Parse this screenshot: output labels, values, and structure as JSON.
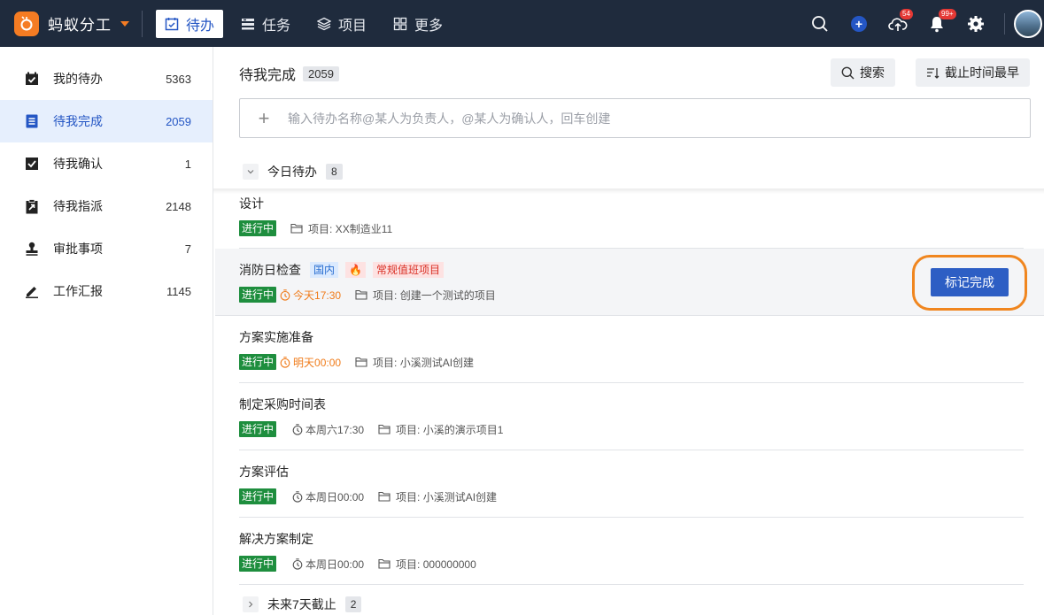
{
  "app": {
    "name": "蚂蚁分工",
    "logo_glyph": "ⓐ"
  },
  "nav": [
    {
      "label": "待办",
      "icon": "todo-icon",
      "active": true
    },
    {
      "label": "任务",
      "icon": "task-icon",
      "active": false
    },
    {
      "label": "项目",
      "icon": "layers-icon",
      "active": false
    },
    {
      "label": "更多",
      "icon": "grid-icon",
      "active": false
    }
  ],
  "top_badges": {
    "cloud": "54",
    "bell": "99+"
  },
  "sidebar": [
    {
      "label": "我的待办",
      "count": "5363",
      "icon": "calendar-check-icon"
    },
    {
      "label": "待我完成",
      "count": "2059",
      "icon": "doc-icon",
      "active": true
    },
    {
      "label": "待我确认",
      "count": "1",
      "icon": "checkbox-icon"
    },
    {
      "label": "待我指派",
      "count": "2148",
      "icon": "assign-icon"
    },
    {
      "label": "审批事项",
      "count": "7",
      "icon": "stamp-icon"
    },
    {
      "label": "工作汇报",
      "count": "1145",
      "icon": "pen-icon"
    }
  ],
  "main": {
    "title": "待我完成",
    "count": "2059",
    "search_label": "搜索",
    "sort_label": "截止时间最早",
    "new_placeholder": "输入待办名称@某人为负责人，@某人为确认人，回车创建"
  },
  "groups": {
    "today": {
      "label": "今日待办",
      "count": "8"
    },
    "next7": {
      "label": "未来7天截止",
      "count": "2"
    }
  },
  "tasks": [
    {
      "title": "设计",
      "status": "进行中",
      "due": "",
      "project": "项目: XX制造业11"
    },
    {
      "title": "消防日检查",
      "status": "进行中",
      "due": "今天17:30",
      "project": "项目: 创建一个测试的项目",
      "tags": [
        "国内",
        "🔥",
        "常规值班项目"
      ],
      "action": "标记完成"
    },
    {
      "title": "方案实施准备",
      "status": "进行中",
      "due": "明天00:00",
      "project": "项目: 小溪测试AI创建"
    },
    {
      "title": "制定采购时间表",
      "status": "进行中",
      "due": "本周六17:30",
      "project": "项目: 小溪的演示项目1"
    },
    {
      "title": "方案评估",
      "status": "进行中",
      "due": "本周日00:00",
      "project": "项目: 小溪测试AI创建"
    },
    {
      "title": "解决方案制定",
      "status": "进行中",
      "due": "本周日00:00",
      "project": "项目: 000000000"
    }
  ],
  "colors": {
    "topbar": "#1f2b3d",
    "accent": "#2456c4",
    "status_green": "#1e8e3e",
    "orange": "#f07c1b"
  }
}
